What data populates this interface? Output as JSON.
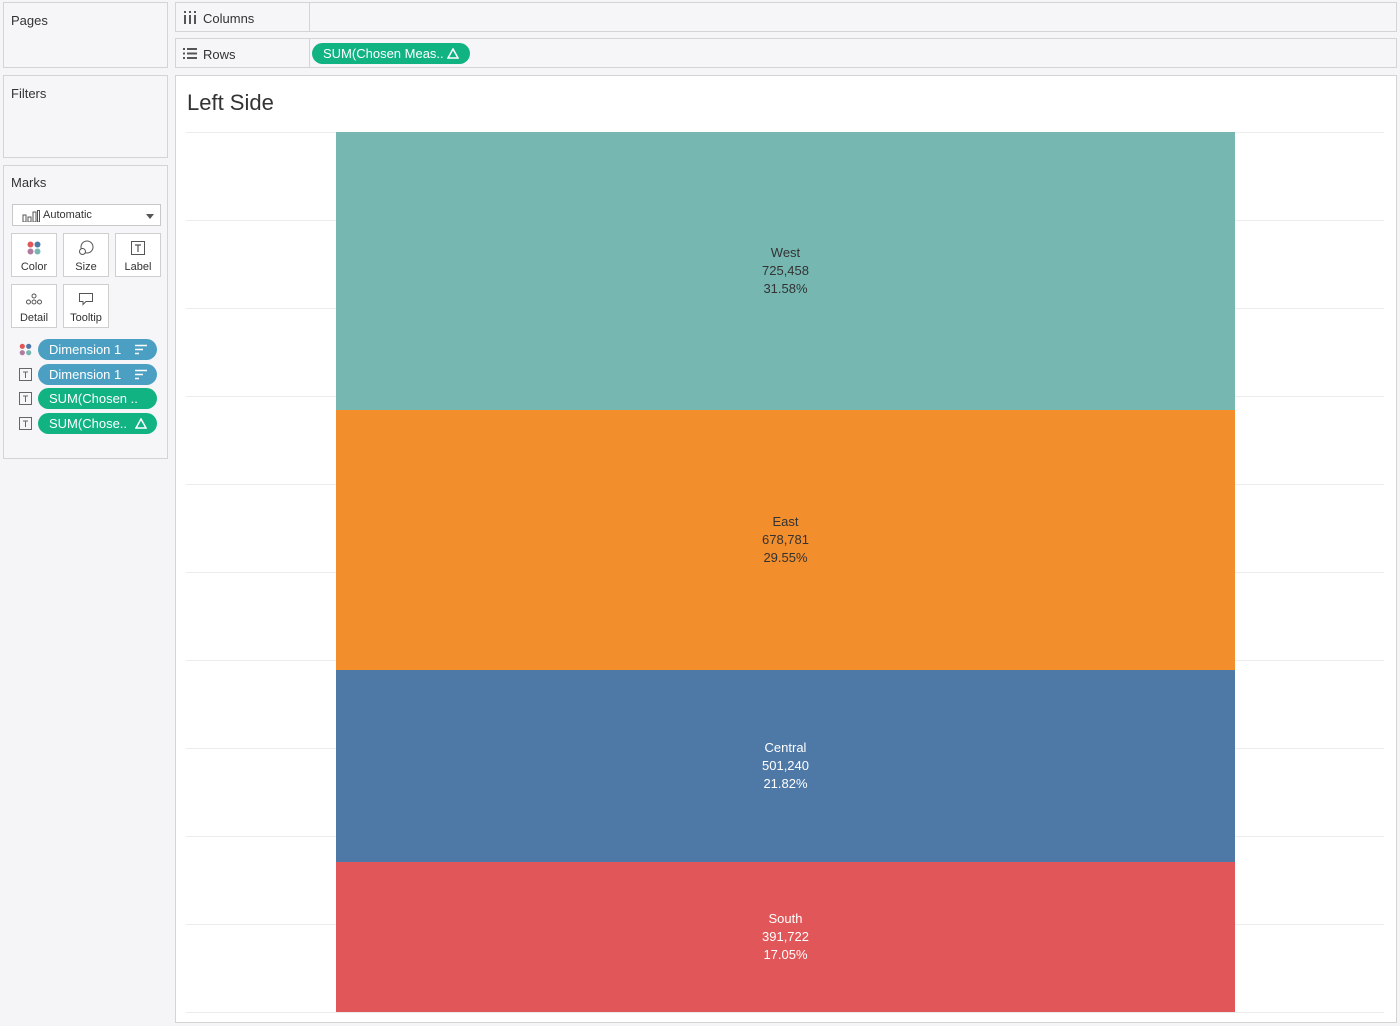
{
  "cards": {
    "pages": "Pages",
    "filters": "Filters",
    "marks": "Marks"
  },
  "marks": {
    "type": "Automatic",
    "buttons": [
      {
        "label": "Color",
        "icon": "color-icon"
      },
      {
        "label": "Size",
        "icon": "size-icon"
      },
      {
        "label": "Label",
        "icon": "label-icon"
      },
      {
        "label": "Detail",
        "icon": "detail-icon"
      },
      {
        "label": "Tooltip",
        "icon": "tooltip-icon"
      }
    ],
    "fields": [
      {
        "label": "Dimension 1",
        "type": "color",
        "style": "blue",
        "icon": "sort-icon"
      },
      {
        "label": "Dimension 1",
        "type": "label",
        "style": "blue",
        "icon": "sort-icon"
      },
      {
        "label": "SUM(Chosen ..",
        "type": "label",
        "style": "green",
        "icon": ""
      },
      {
        "label": "SUM(Chose..",
        "type": "label",
        "style": "green",
        "icon": "delta-icon"
      }
    ]
  },
  "shelves": {
    "columns": "Columns",
    "rows": "Rows",
    "rows_pill": "SUM(Chosen Meas.."
  },
  "view": {
    "title": "Left Side"
  },
  "chart_data": {
    "type": "bar",
    "stacked": true,
    "orientation": "vertical",
    "categories": [
      "West",
      "East",
      "Central",
      "South"
    ],
    "values": [
      725458,
      678781,
      501240,
      391722
    ],
    "value_labels": [
      "725,458",
      "678,781",
      "501,240",
      "391,722"
    ],
    "percent_labels": [
      "31.58%",
      "29.55%",
      "21.82%",
      "17.05%"
    ],
    "colors": [
      "#76b7b2",
      "#f28e2b",
      "#4e79a7",
      "#e15759"
    ],
    "label_colors": [
      "#333333",
      "#333333",
      "#ffffff",
      "#ffffff"
    ],
    "grid": true,
    "gridline_count": 10,
    "title": "Left Side"
  }
}
